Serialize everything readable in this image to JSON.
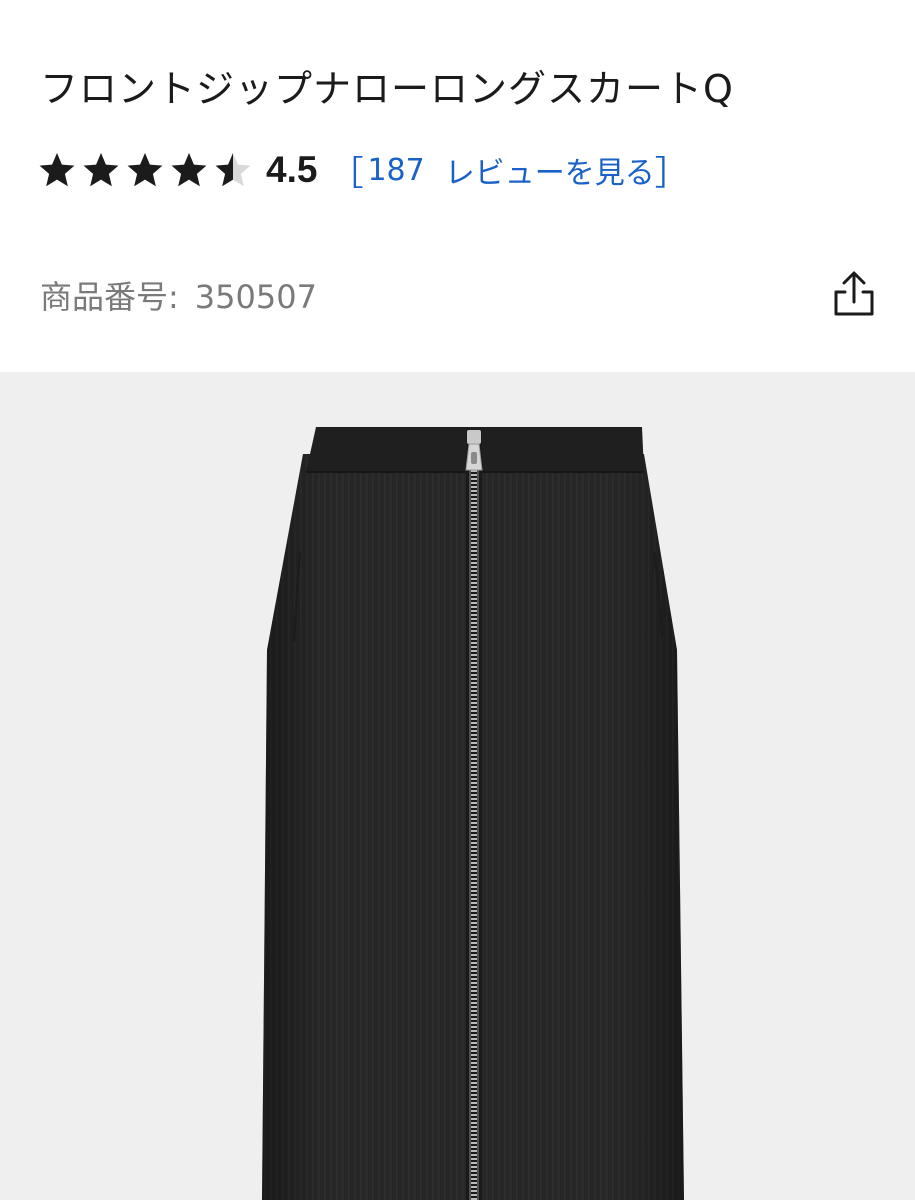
{
  "product": {
    "title": "フロントジップナローロングスカートQ",
    "rating": {
      "value": 4.5,
      "value_label": "4.5",
      "max": 5,
      "review_count": "187",
      "review_link_label": "レビューを見る"
    },
    "number_label": "商品番号:",
    "number_value": "350507"
  },
  "icons": {
    "star": "star-icon",
    "share": "share-icon"
  },
  "colors": {
    "text": "#1b1b1b",
    "link": "#1a62c8",
    "muted": "#7a7a7a",
    "image_bg": "#efefef",
    "skirt": "#262626"
  }
}
